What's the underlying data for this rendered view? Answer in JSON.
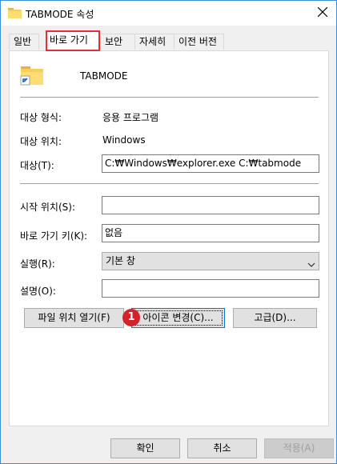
{
  "window": {
    "title": "TABMODE 속성",
    "close_icon": "close-icon"
  },
  "tabs": [
    {
      "label": "일반"
    },
    {
      "label": "바로 가기"
    },
    {
      "label": "보안"
    },
    {
      "label": "자세히"
    },
    {
      "label": "이전 버전"
    }
  ],
  "header": {
    "name": "TABMODE",
    "icon": "shortcut-folder-icon"
  },
  "info": {
    "type_label": "대상 형식:",
    "type_value": "응용 프로그램",
    "location_label": "대상 위치:",
    "location_value": "Windows"
  },
  "target": {
    "label": "대상(T):",
    "value": "C:₩Windows₩explorer.exe C:₩tabmode"
  },
  "start_in": {
    "label": "시작 위치(S):",
    "value": ""
  },
  "shortcut_key": {
    "label": "바로 가기 키(K):",
    "value": "없음"
  },
  "run": {
    "label": "실행(R):",
    "value": "기본 창"
  },
  "comment": {
    "label": "설명(O):",
    "value": ""
  },
  "buttons": {
    "open_location": "파일 위치 열기(F)",
    "change_icon": "아이콘 변경(C)...",
    "advanced": "고급(D)..."
  },
  "badge": "1",
  "footer": {
    "ok": "확인",
    "cancel": "취소",
    "apply": "적용(A)"
  },
  "colors": {
    "highlight": "#e0312f",
    "badge": "#d2232a",
    "focus": "#0078d7"
  }
}
